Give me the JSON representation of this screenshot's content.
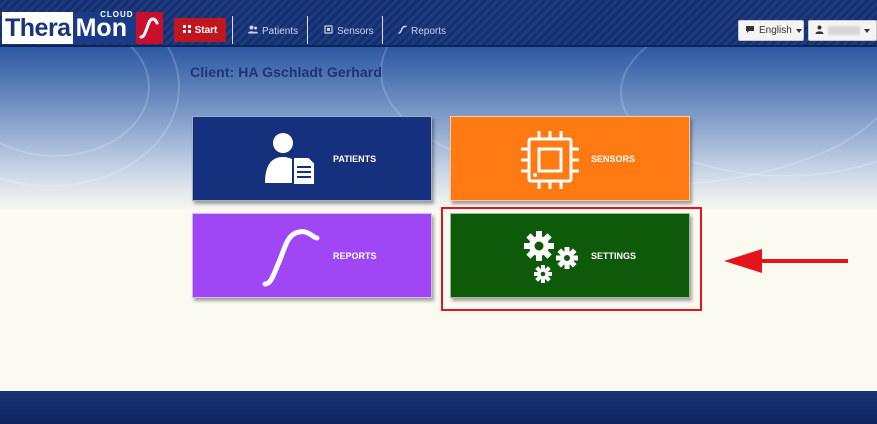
{
  "app": {
    "logo_thera": "Thera",
    "logo_mon": "Mon",
    "logo_cloud": "CLOUD"
  },
  "nav": {
    "start": "Start",
    "patients": "Patients",
    "sensors": "Sensors",
    "reports": "Reports"
  },
  "language": {
    "selected": "English"
  },
  "client": {
    "label": "Client: HA Gschladt Gerhard"
  },
  "tiles": {
    "patients": "PATIENTS",
    "sensors": "SENSORS",
    "reports": "REPORTS",
    "settings": "SETTINGS"
  },
  "colors": {
    "patients": "#15307c",
    "sensors": "#ff7a12",
    "reports": "#a047f5",
    "settings": "#0d5a0a",
    "start": "#c0171f",
    "highlight": "#e3141c"
  },
  "icons": {
    "start": "grid-icon",
    "patients_nav": "users-icon",
    "sensors_nav": "chip-icon",
    "reports_nav": "wave-icon",
    "language": "comment-icon",
    "user": "user-icon"
  }
}
